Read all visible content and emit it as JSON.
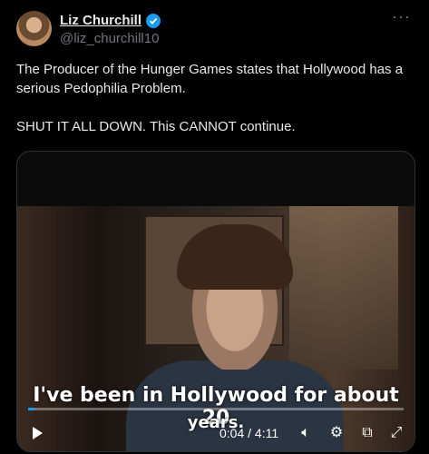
{
  "author": {
    "name": "Liz Churchill",
    "handle": "@liz_churchill10"
  },
  "tweet": {
    "paragraph1": "The Producer of the Hunger Games states that Hollywood has a serious Pedophilia Problem.",
    "paragraph2": "SHUT IT ALL DOWN. This CANNOT continue."
  },
  "video": {
    "caption_line1": "I've been in Hollywood for about 20",
    "caption_line2": "years.",
    "time": "0:04 / 4:11",
    "progress_fraction": 0.016
  },
  "icons": {
    "more": "more-icon",
    "verified": "verified-badge-icon",
    "play": "play-icon",
    "mute": "mute-icon",
    "settings": "settings-icon",
    "pip": "picture-in-picture-icon",
    "fullscreen": "fullscreen-icon"
  },
  "colors": {
    "accent": "#1d9bf0",
    "text_primary": "#e7e9ea",
    "text_secondary": "#71767b"
  }
}
